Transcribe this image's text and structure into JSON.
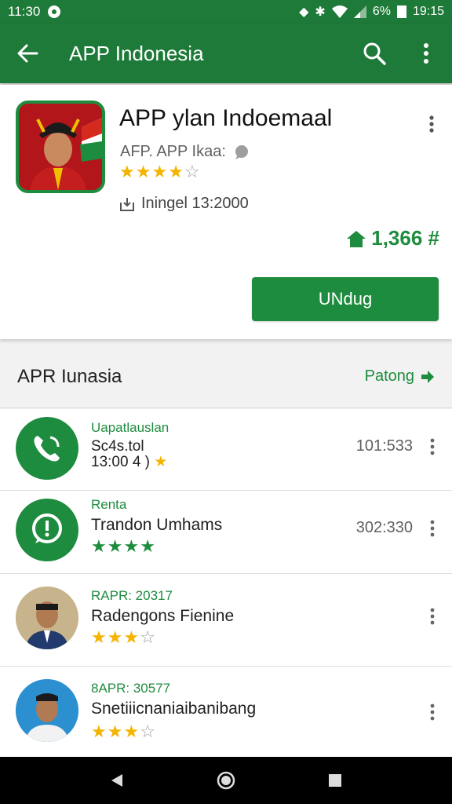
{
  "status_bar": {
    "time": "11:30",
    "battery": "6%",
    "clock_right": "19:15"
  },
  "app_bar": {
    "title": "APP Indonesia"
  },
  "featured": {
    "title": "APP  ylan Indoemaal",
    "developer": "AFP. APP Ikaa:",
    "rating": 4,
    "installs": "Iningel 13:2000",
    "price": "1,366 #",
    "install_label": "UNdug"
  },
  "section": {
    "title": "APR Iunasia",
    "more_label": "Patong"
  },
  "list": [
    {
      "category": "Uapatlauslan",
      "name": "Sc4s.tol",
      "sub": "13:00 4 )",
      "meta": "101:533",
      "icon": "phone-icon"
    },
    {
      "category": "Renta",
      "name": "Trandon Umhams",
      "meta": "302:330",
      "rating": 3.5,
      "icon": "alert-chat-icon"
    },
    {
      "category": "RAPR: 20317",
      "name": "Radengons Fienine",
      "rating": 3,
      "icon": "avatar-man-cap"
    },
    {
      "category": "8APR: 30577",
      "name": "Snetiiicnaniaibanibang",
      "rating": 3,
      "icon": "avatar-man-peci"
    }
  ],
  "colors": {
    "primary": "#1e7a38",
    "accent": "#1e8c3e",
    "star": "#f4b400"
  }
}
